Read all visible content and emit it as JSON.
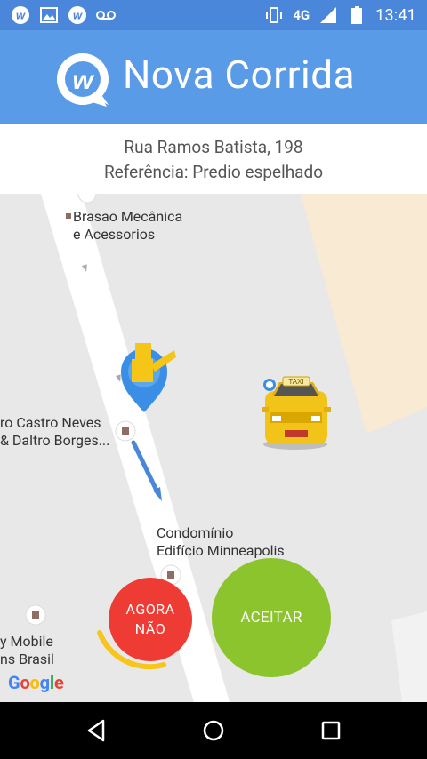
{
  "status_bar": {
    "network": "4G",
    "time": "13:41",
    "icons": [
      "w-app-icon",
      "image-icon",
      "w-app-icon",
      "voicemail-icon",
      "vibrate-icon",
      "signal-icon",
      "battery-icon"
    ]
  },
  "app_bar": {
    "title": "Nova Corrida"
  },
  "address": {
    "street": "Rua Ramos Batista, 198",
    "reference": "Referência: Predio espelhado"
  },
  "map": {
    "poi_brasao_line1": "Brasao Mecânica",
    "poi_brasao_line2": "e Acessorios",
    "poi_castro_line1": "ro Castro Neves",
    "poi_castro_line2": "& Daltro Borges...",
    "poi_condo_line1": "Condomínio",
    "poi_condo_line2": "Edifício Minneapolis",
    "poi_mobile_line1": "y Mobile",
    "poi_mobile_line2": "ns Brasil",
    "taxi_sign": "TAXI",
    "google": [
      "G",
      "o",
      "o",
      "g",
      "l",
      "e"
    ],
    "google_colors": [
      "#4285F4",
      "#EA4335",
      "#FBBC05",
      "#4285F4",
      "#34A853",
      "#EA4335"
    ]
  },
  "actions": {
    "decline_line1": "AGORA",
    "decline_line2": "NÃO",
    "accept": "ACEITAR"
  },
  "colors": {
    "status_bar": "#4a86d9",
    "app_bar": "#5a9be8",
    "decline": "#ee3b33",
    "accept": "#8bc42c",
    "timer_arc": "#f7c51c",
    "route": "#4a86d9"
  }
}
